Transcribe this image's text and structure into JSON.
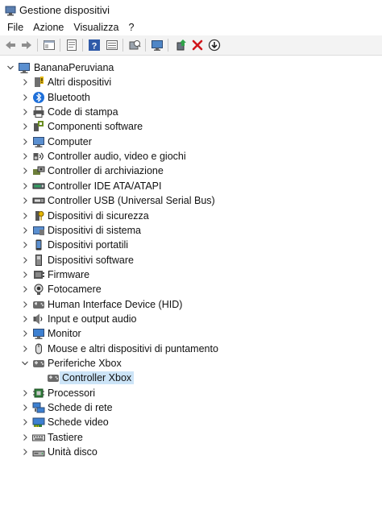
{
  "window": {
    "title": "Gestione dispositivi"
  },
  "menu": {
    "items": [
      "File",
      "Azione",
      "Visualizza",
      "?"
    ]
  },
  "toolbar": {
    "buttons": [
      "back-icon",
      "forward-icon",
      "view-icon",
      "properties-icon",
      "help-icon",
      "details-icon",
      "scan-icon",
      "monitor-icon",
      "update-driver-icon",
      "uninstall-icon",
      "download-icon"
    ]
  },
  "tree": {
    "root": "BananaPeruviana",
    "items": [
      {
        "label": "Altri dispositivi",
        "icon": "unknown-device-icon"
      },
      {
        "label": "Bluetooth",
        "icon": "bluetooth-icon"
      },
      {
        "label": "Code di stampa",
        "icon": "printer-icon"
      },
      {
        "label": "Componenti software",
        "icon": "software-component-icon"
      },
      {
        "label": "Computer",
        "icon": "computer-icon"
      },
      {
        "label": "Controller audio, video e giochi",
        "icon": "audio-icon"
      },
      {
        "label": "Controller di archiviazione",
        "icon": "storage-controller-icon"
      },
      {
        "label": "Controller IDE ATA/ATAPI",
        "icon": "ide-icon"
      },
      {
        "label": "Controller USB (Universal Serial Bus)",
        "icon": "usb-icon"
      },
      {
        "label": "Dispositivi di sicurezza",
        "icon": "security-icon"
      },
      {
        "label": "Dispositivi di sistema",
        "icon": "system-device-icon"
      },
      {
        "label": "Dispositivi portatili",
        "icon": "portable-device-icon"
      },
      {
        "label": "Dispositivi software",
        "icon": "software-device-icon"
      },
      {
        "label": "Firmware",
        "icon": "firmware-icon"
      },
      {
        "label": "Fotocamere",
        "icon": "camera-icon"
      },
      {
        "label": "Human Interface Device (HID)",
        "icon": "hid-icon"
      },
      {
        "label": "Input e output audio",
        "icon": "speaker-icon"
      },
      {
        "label": "Monitor",
        "icon": "monitor-icon"
      },
      {
        "label": "Mouse e altri dispositivi di puntamento",
        "icon": "mouse-icon"
      },
      {
        "label": "Periferiche Xbox",
        "icon": "xbox-peripheral-icon",
        "expanded": true,
        "children": [
          {
            "label": "Controller Xbox",
            "icon": "gamepad-icon",
            "selected": true
          }
        ]
      },
      {
        "label": "Processori",
        "icon": "processor-icon"
      },
      {
        "label": "Schede di rete",
        "icon": "network-adapter-icon"
      },
      {
        "label": "Schede video",
        "icon": "display-adapter-icon"
      },
      {
        "label": "Tastiere",
        "icon": "keyboard-icon"
      },
      {
        "label": "Unità disco",
        "icon": "disk-drive-icon"
      }
    ]
  }
}
